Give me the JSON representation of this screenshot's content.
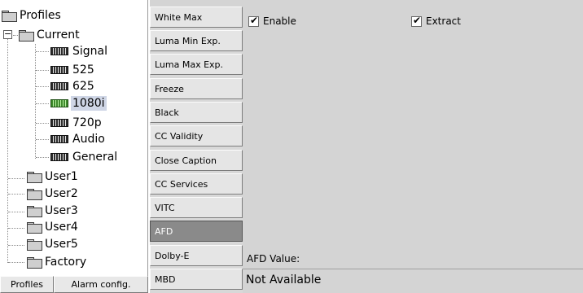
{
  "tree": {
    "items": [
      {
        "label": "Profiles",
        "icon": "folder-icon"
      },
      {
        "label": "Current",
        "icon": "folder-icon"
      },
      {
        "label": "Signal",
        "icon": "card-icon"
      },
      {
        "label": "525",
        "icon": "card-icon"
      },
      {
        "label": "625",
        "icon": "card-icon"
      },
      {
        "label": "1080i",
        "icon": "card-icon-green",
        "selected": true
      },
      {
        "label": "720p",
        "icon": "card-icon"
      },
      {
        "label": "Audio",
        "icon": "card-icon"
      },
      {
        "label": "General",
        "icon": "card-icon"
      },
      {
        "label": "User1",
        "icon": "folder-icon"
      },
      {
        "label": "User2",
        "icon": "folder-icon"
      },
      {
        "label": "User3",
        "icon": "folder-icon"
      },
      {
        "label": "User4",
        "icon": "folder-icon"
      },
      {
        "label": "User5",
        "icon": "folder-icon"
      },
      {
        "label": "Factory",
        "icon": "folder-icon"
      }
    ],
    "expander_symbol": "−"
  },
  "bottom_buttons": {
    "profiles": "Profiles",
    "alarm_config": "Alarm config."
  },
  "tabs": [
    {
      "label": "White Max"
    },
    {
      "label": "Luma Min Exp."
    },
    {
      "label": "Luma Max Exp."
    },
    {
      "label": "Freeze"
    },
    {
      "label": "Black"
    },
    {
      "label": "CC Validity"
    },
    {
      "label": "Close Caption"
    },
    {
      "label": "CC Services"
    },
    {
      "label": "VITC"
    },
    {
      "label": "AFD",
      "active": true
    },
    {
      "label": "Dolby-E"
    },
    {
      "label": "MBD"
    }
  ],
  "content": {
    "enable": {
      "label": "Enable",
      "checked": true
    },
    "extract": {
      "label": "Extract",
      "checked": true
    },
    "checkmark": "✔",
    "afd_label": "AFD Value:",
    "afd_value": "Not Available"
  },
  "colors": {
    "panel_bg": "#d4d4d4",
    "active_tab": "#8a8a8a",
    "selected_card": "#3f8a2c"
  }
}
